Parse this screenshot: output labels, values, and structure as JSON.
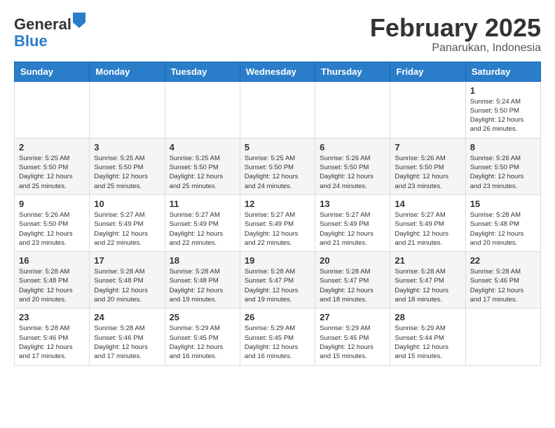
{
  "header": {
    "logo_line1": "General",
    "logo_line2": "Blue",
    "month_title": "February 2025",
    "location": "Panarukan, Indonesia"
  },
  "calendar": {
    "weekdays": [
      "Sunday",
      "Monday",
      "Tuesday",
      "Wednesday",
      "Thursday",
      "Friday",
      "Saturday"
    ],
    "weeks": [
      [
        {
          "day": "",
          "info": ""
        },
        {
          "day": "",
          "info": ""
        },
        {
          "day": "",
          "info": ""
        },
        {
          "day": "",
          "info": ""
        },
        {
          "day": "",
          "info": ""
        },
        {
          "day": "",
          "info": ""
        },
        {
          "day": "1",
          "info": "Sunrise: 5:24 AM\nSunset: 5:50 PM\nDaylight: 12 hours\nand 26 minutes."
        }
      ],
      [
        {
          "day": "2",
          "info": "Sunrise: 5:25 AM\nSunset: 5:50 PM\nDaylight: 12 hours\nand 25 minutes."
        },
        {
          "day": "3",
          "info": "Sunrise: 5:25 AM\nSunset: 5:50 PM\nDaylight: 12 hours\nand 25 minutes."
        },
        {
          "day": "4",
          "info": "Sunrise: 5:25 AM\nSunset: 5:50 PM\nDaylight: 12 hours\nand 25 minutes."
        },
        {
          "day": "5",
          "info": "Sunrise: 5:25 AM\nSunset: 5:50 PM\nDaylight: 12 hours\nand 24 minutes."
        },
        {
          "day": "6",
          "info": "Sunrise: 5:26 AM\nSunset: 5:50 PM\nDaylight: 12 hours\nand 24 minutes."
        },
        {
          "day": "7",
          "info": "Sunrise: 5:26 AM\nSunset: 5:50 PM\nDaylight: 12 hours\nand 23 minutes."
        },
        {
          "day": "8",
          "info": "Sunrise: 5:26 AM\nSunset: 5:50 PM\nDaylight: 12 hours\nand 23 minutes."
        }
      ],
      [
        {
          "day": "9",
          "info": "Sunrise: 5:26 AM\nSunset: 5:50 PM\nDaylight: 12 hours\nand 23 minutes."
        },
        {
          "day": "10",
          "info": "Sunrise: 5:27 AM\nSunset: 5:49 PM\nDaylight: 12 hours\nand 22 minutes."
        },
        {
          "day": "11",
          "info": "Sunrise: 5:27 AM\nSunset: 5:49 PM\nDaylight: 12 hours\nand 22 minutes."
        },
        {
          "day": "12",
          "info": "Sunrise: 5:27 AM\nSunset: 5:49 PM\nDaylight: 12 hours\nand 22 minutes."
        },
        {
          "day": "13",
          "info": "Sunrise: 5:27 AM\nSunset: 5:49 PM\nDaylight: 12 hours\nand 21 minutes."
        },
        {
          "day": "14",
          "info": "Sunrise: 5:27 AM\nSunset: 5:49 PM\nDaylight: 12 hours\nand 21 minutes."
        },
        {
          "day": "15",
          "info": "Sunrise: 5:28 AM\nSunset: 5:48 PM\nDaylight: 12 hours\nand 20 minutes."
        }
      ],
      [
        {
          "day": "16",
          "info": "Sunrise: 5:28 AM\nSunset: 5:48 PM\nDaylight: 12 hours\nand 20 minutes."
        },
        {
          "day": "17",
          "info": "Sunrise: 5:28 AM\nSunset: 5:48 PM\nDaylight: 12 hours\nand 20 minutes."
        },
        {
          "day": "18",
          "info": "Sunrise: 5:28 AM\nSunset: 5:48 PM\nDaylight: 12 hours\nand 19 minutes."
        },
        {
          "day": "19",
          "info": "Sunrise: 5:28 AM\nSunset: 5:47 PM\nDaylight: 12 hours\nand 19 minutes."
        },
        {
          "day": "20",
          "info": "Sunrise: 5:28 AM\nSunset: 5:47 PM\nDaylight: 12 hours\nand 18 minutes."
        },
        {
          "day": "21",
          "info": "Sunrise: 5:28 AM\nSunset: 5:47 PM\nDaylight: 12 hours\nand 18 minutes."
        },
        {
          "day": "22",
          "info": "Sunrise: 5:28 AM\nSunset: 5:46 PM\nDaylight: 12 hours\nand 17 minutes."
        }
      ],
      [
        {
          "day": "23",
          "info": "Sunrise: 5:28 AM\nSunset: 5:46 PM\nDaylight: 12 hours\nand 17 minutes."
        },
        {
          "day": "24",
          "info": "Sunrise: 5:28 AM\nSunset: 5:46 PM\nDaylight: 12 hours\nand 17 minutes."
        },
        {
          "day": "25",
          "info": "Sunrise: 5:29 AM\nSunset: 5:45 PM\nDaylight: 12 hours\nand 16 minutes."
        },
        {
          "day": "26",
          "info": "Sunrise: 5:29 AM\nSunset: 5:45 PM\nDaylight: 12 hours\nand 16 minutes."
        },
        {
          "day": "27",
          "info": "Sunrise: 5:29 AM\nSunset: 5:45 PM\nDaylight: 12 hours\nand 15 minutes."
        },
        {
          "day": "28",
          "info": "Sunrise: 5:29 AM\nSunset: 5:44 PM\nDaylight: 12 hours\nand 15 minutes."
        },
        {
          "day": "",
          "info": ""
        }
      ]
    ]
  }
}
